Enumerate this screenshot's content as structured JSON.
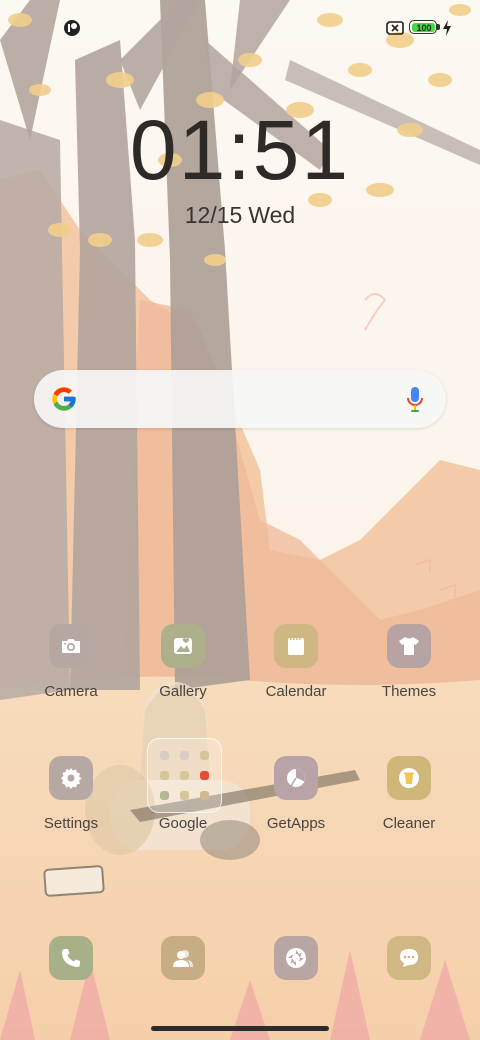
{
  "status_bar": {
    "notification_icon": "circle-badge-icon",
    "sim_icon": "no-sim-icon",
    "battery_level": 100,
    "battery_text": "100",
    "charging_icon": "bolt-icon"
  },
  "clock": {
    "time": "01:51",
    "date": "12/15",
    "day": "Wed"
  },
  "search": {
    "logo": "google-g-icon",
    "mic": "microphone-icon"
  },
  "apps": {
    "camera": {
      "label": "Camera",
      "icon": "camera-icon",
      "color": "#b7a7a2"
    },
    "gallery": {
      "label": "Gallery",
      "icon": "photo-icon",
      "color": "#aeb08b"
    },
    "calendar": {
      "label": "Calendar",
      "icon": "calendar-icon",
      "color": "#cfb784"
    },
    "themes": {
      "label": "Themes",
      "icon": "tshirt-icon",
      "color": "#b6a3a2"
    },
    "settings": {
      "label": "Settings",
      "icon": "gear-icon",
      "color": "#b6a8a3"
    },
    "google": {
      "label": "Google",
      "icon": "folder-icon"
    },
    "getapps": {
      "label": "GetApps",
      "icon": "pie-chart-icon",
      "color": "#b8a4a6"
    },
    "cleaner": {
      "label": "Cleaner",
      "icon": "trash-icon",
      "color": "#cfb77a"
    }
  },
  "dock": {
    "phone": {
      "icon": "phone-icon",
      "color": "#a7b088"
    },
    "contacts": {
      "icon": "contacts-icon",
      "color": "#c6ad83"
    },
    "camera_alt": {
      "icon": "aperture-icon",
      "color": "#b8a6a5"
    },
    "messages": {
      "icon": "chat-bubble-icon",
      "color": "#cfb883"
    }
  },
  "colors": {
    "wallpaper_sky": "#fbf6ee",
    "wallpaper_ground": "#f6d7b3",
    "tree_trunk": "#b9aca4",
    "leaves": "#f1cf8a"
  }
}
